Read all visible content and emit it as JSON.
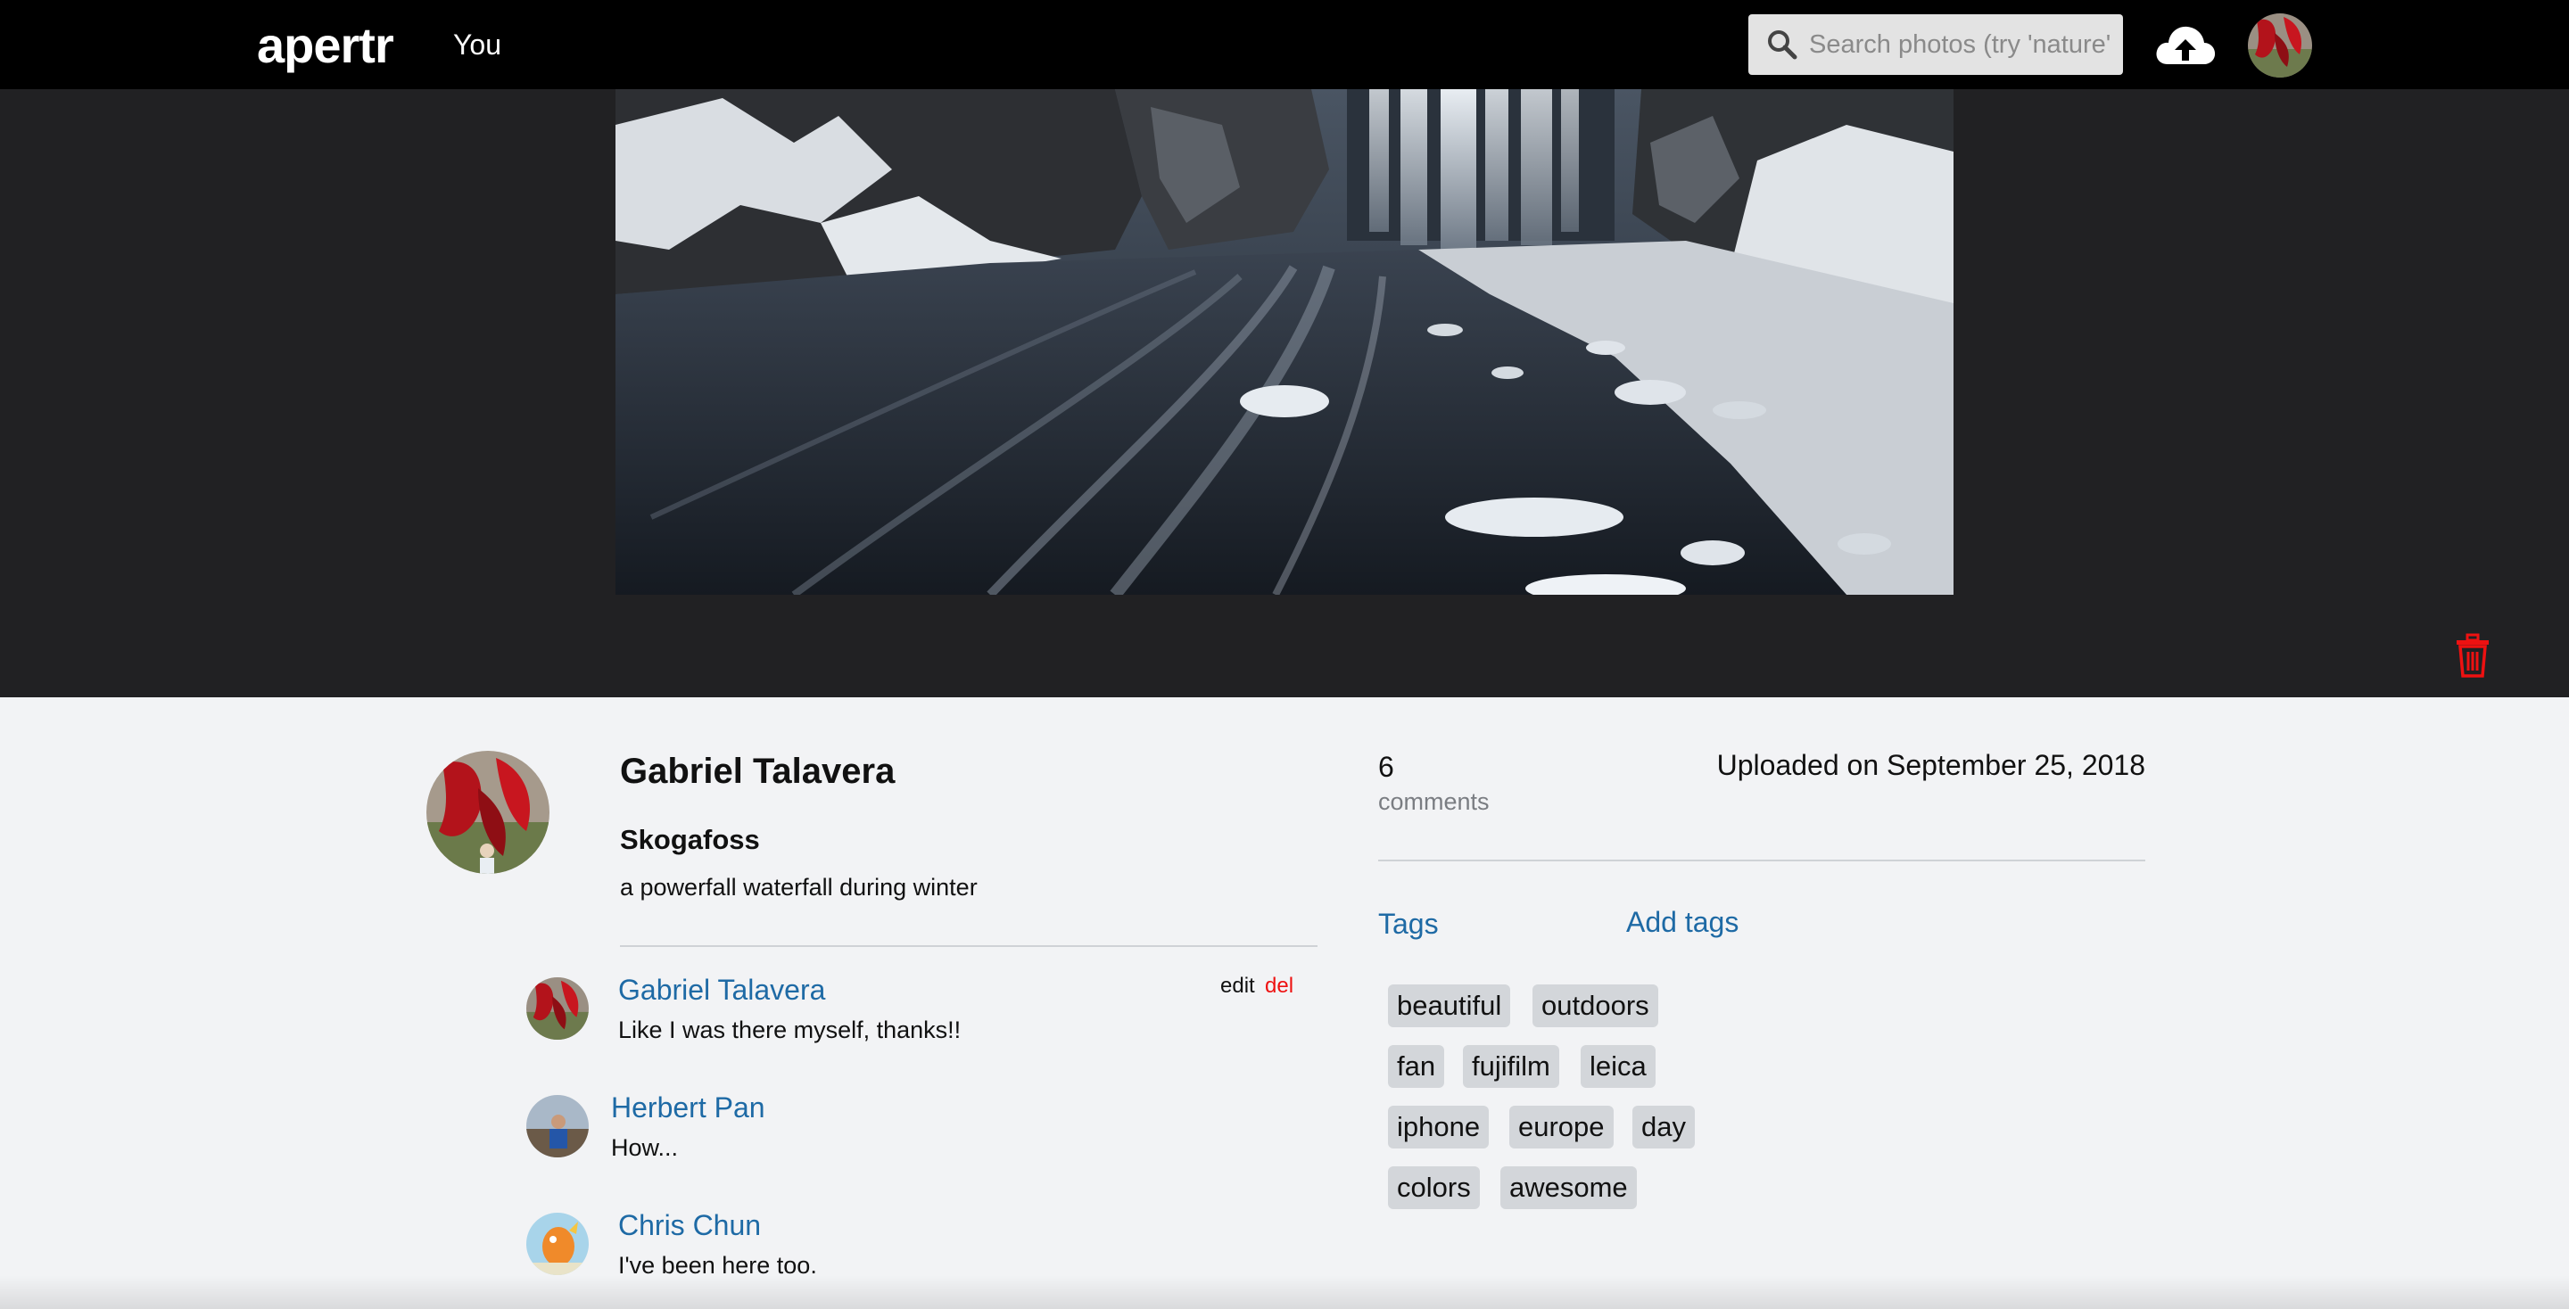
{
  "nav": {
    "logo": "apertr",
    "you_label": "You",
    "search_placeholder": "Search photos (try 'nature', 'dog')"
  },
  "photo": {
    "owner": "Gabriel Talavera",
    "title": "Skogafoss",
    "description": "a powerfall waterfall during winter",
    "comments_count": "6",
    "comments_label": "comments",
    "uploaded": "Uploaded on September 25, 2018"
  },
  "comments": [
    {
      "author": "Gabriel Talavera",
      "text": "Like I was there myself, thanks!!",
      "edit_label": "edit",
      "del_label": "del"
    },
    {
      "author": "Herbert Pan",
      "text": "How..."
    },
    {
      "author": "Chris Chun",
      "text": "I've been here too."
    }
  ],
  "tags": {
    "heading": "Tags",
    "add_label": "Add tags",
    "items": [
      "beautiful",
      "outdoors",
      "fan",
      "fujifilm",
      "leica",
      "iphone",
      "europe",
      "day",
      "colors",
      "awesome"
    ]
  },
  "colors": {
    "link": "#1e6aa5",
    "danger": "#e11111",
    "stage_bg": "#212123",
    "nav_bg": "#000000"
  },
  "icons": [
    "search-icon",
    "cloud-upload-icon",
    "trash-icon"
  ]
}
